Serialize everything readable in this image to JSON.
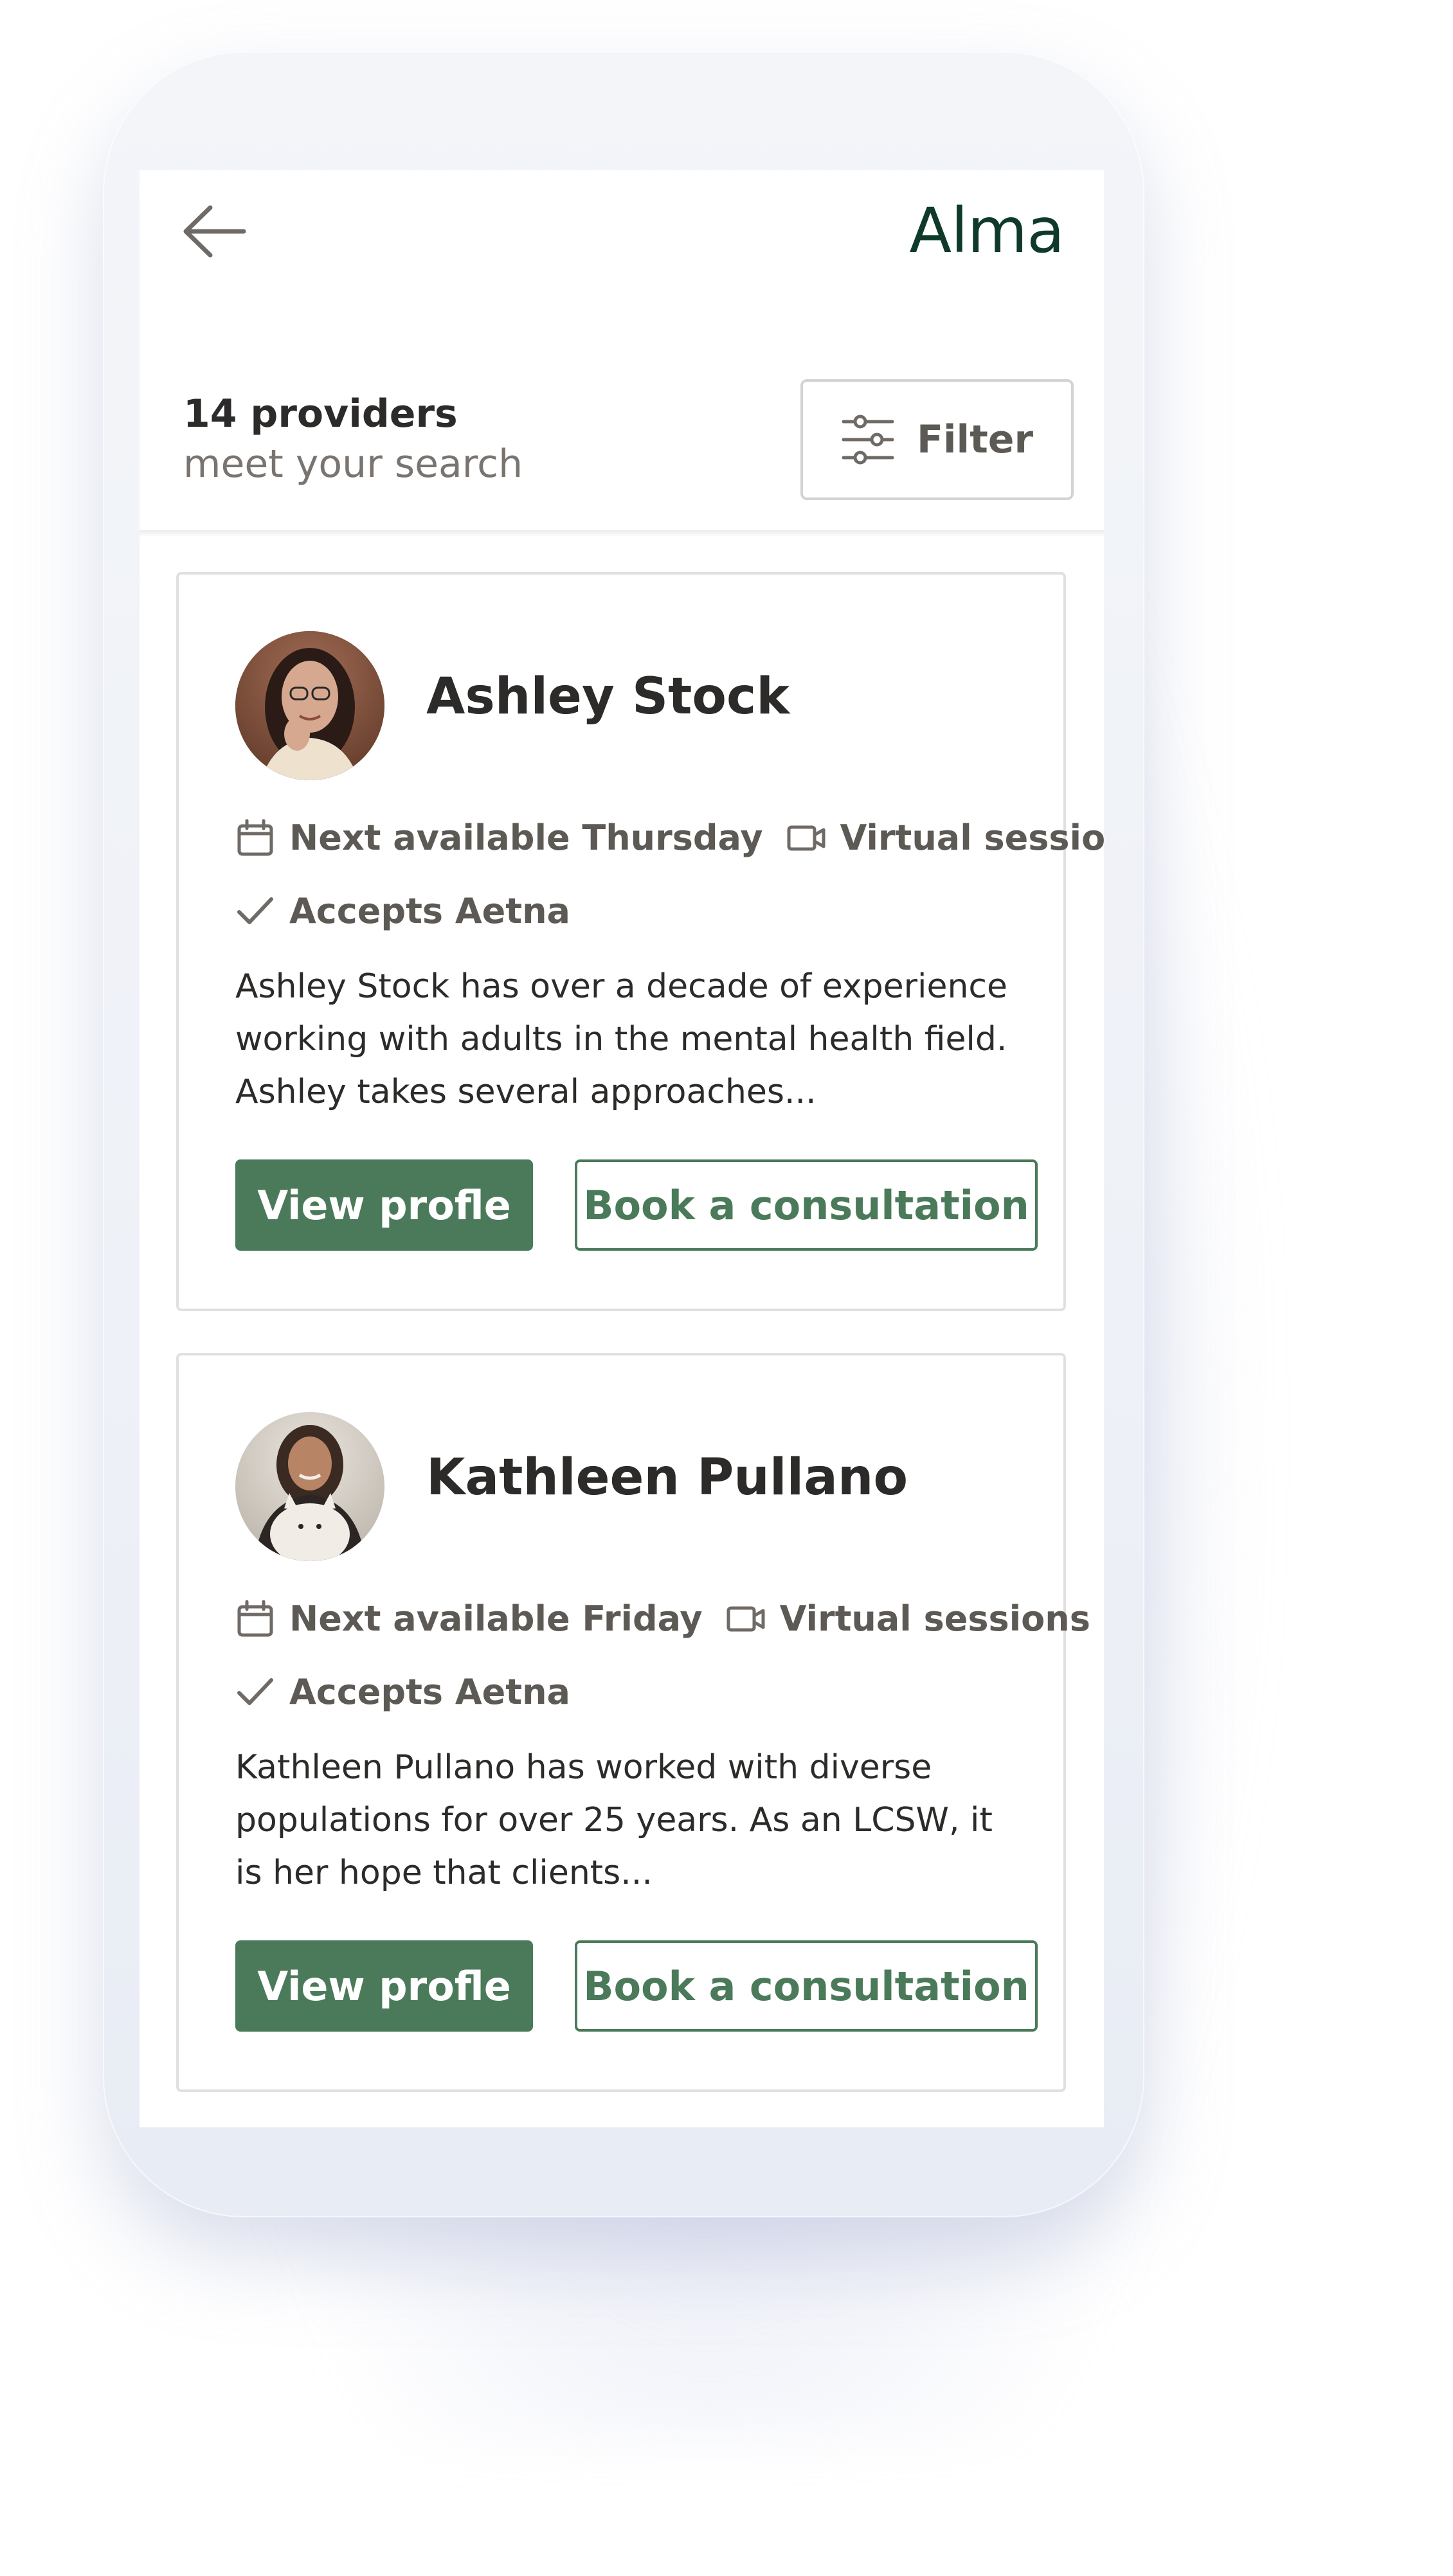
{
  "header": {
    "logo": "Alma",
    "back_icon": "arrow-left-icon"
  },
  "results": {
    "count_label": "14 providers",
    "sub_label": "meet your search",
    "filter_label": "Filter",
    "filter_icon": "sliders-icon"
  },
  "providers": [
    {
      "name": "Ashley Stock",
      "availability": "Next available Thursday",
      "session_type": "Virtual sessions",
      "insurance": "Accepts Aetna",
      "bio": "Ashley Stock has over a decade of experience working with adults in the mental health field. Ashley takes several approaches...",
      "view_label": "View profle",
      "book_label": "Book a consultation"
    },
    {
      "name": "Kathleen Pullano",
      "availability": "Next available Friday",
      "session_type": "Virtual sessions",
      "insurance": "Accepts Aetna",
      "bio": "Kathleen Pullano has worked with diverse populations for over 25 years. As an LCSW, it is her hope that clients...",
      "view_label": "View profle",
      "book_label": "Book a consultation"
    }
  ],
  "colors": {
    "brand_green": "#4b7a5a",
    "logo_green": "#0f3a2a",
    "text_dark": "#2d2b29",
    "text_muted": "#5d5955"
  }
}
